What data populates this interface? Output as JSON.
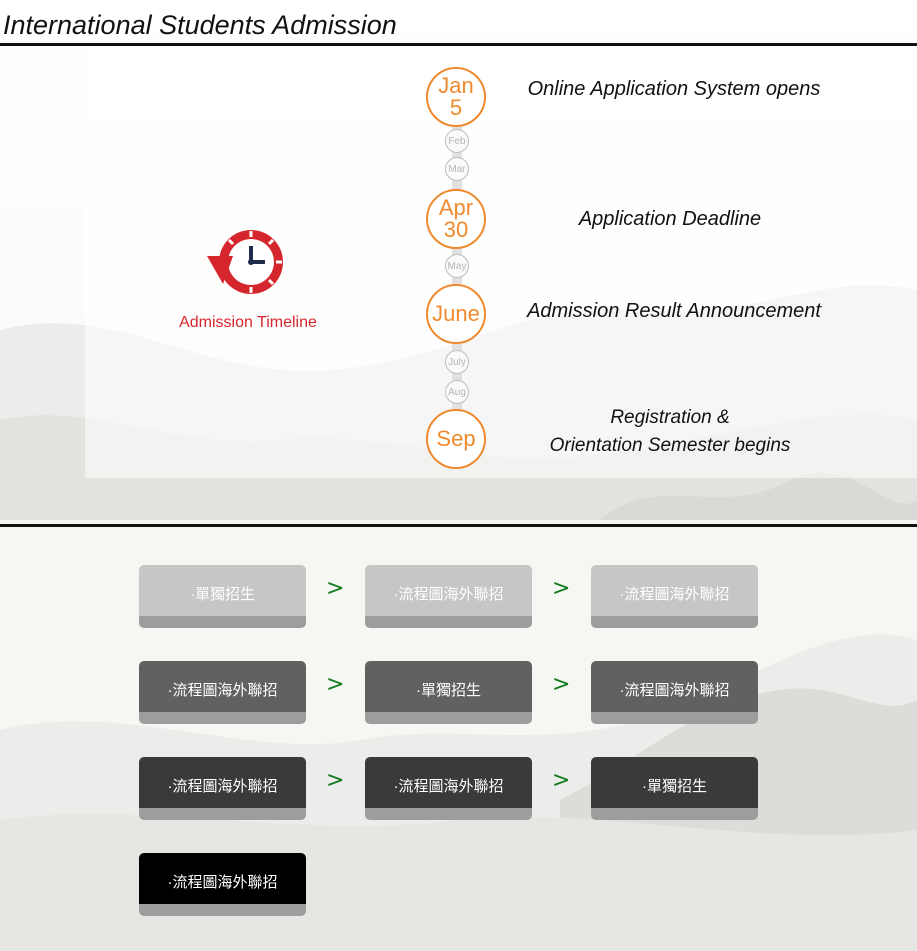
{
  "page": {
    "title": "International Students Admission"
  },
  "timeline": {
    "icon": "clock-reset-icon",
    "caption": "Admission Timeline",
    "months": [
      {
        "big": true,
        "line1": "Jan",
        "line2": "5"
      },
      {
        "big": false,
        "line1": "Feb"
      },
      {
        "big": false,
        "line1": "Mar"
      },
      {
        "big": true,
        "line1": "Apr",
        "line2": "30"
      },
      {
        "big": false,
        "line1": "May"
      },
      {
        "big": true,
        "line1": "June"
      },
      {
        "big": false,
        "line1": "July"
      },
      {
        "big": false,
        "line1": "Aug"
      },
      {
        "big": true,
        "line1": "Sep"
      }
    ],
    "events": [
      "Online Application System opens",
      "Application Deadline",
      "Admission Result Announcement",
      "Registration &",
      "Orientation Semester begins"
    ]
  },
  "flow": {
    "arrow": ">",
    "rows": [
      [
        "·單獨招生",
        "·流程圖海外聯招",
        "·流程圖海外聯招"
      ],
      [
        "·流程圖海外聯招",
        "·單獨招生",
        "·流程圖海外聯招"
      ],
      [
        "·流程圖海外聯招",
        "·流程圖海外聯招",
        "·單獨招生"
      ],
      [
        "·流程圖海外聯招"
      ]
    ]
  },
  "colors": {
    "accent_orange": "#ef8a2e",
    "caption_red": "#d6262d",
    "arrow_green": "#117a1e"
  }
}
